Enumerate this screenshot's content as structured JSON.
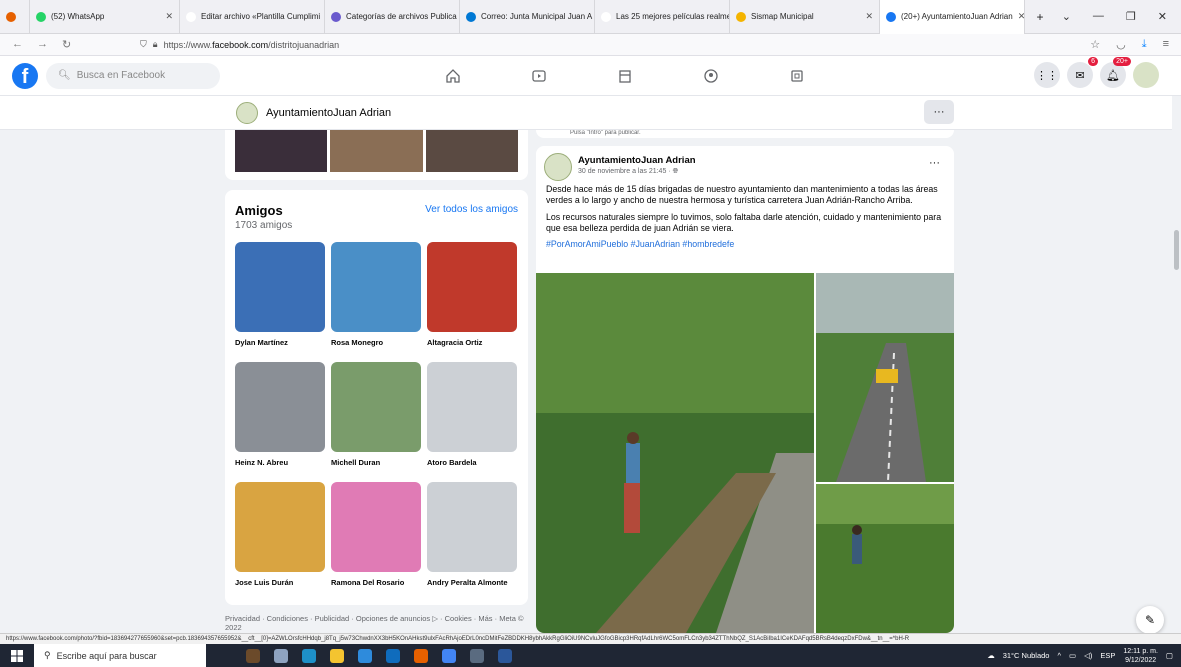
{
  "browser": {
    "tabs": [
      {
        "label": "(52) WhatsApp",
        "color": "#25d366",
        "width": 150
      },
      {
        "label": "Editar archivo «Plantilla Cumplimi",
        "color": "#ffffff",
        "width": 145
      },
      {
        "label": "Categorías de archivos Publica",
        "color": "#6a5acd",
        "width": 135
      },
      {
        "label": "Correo: Junta Municipal Juan A",
        "color": "#0078d4",
        "width": 135
      },
      {
        "label": "Las 25 mejores películas realmente",
        "color": "#ffffff",
        "width": 135
      },
      {
        "label": "Sismap Municipal",
        "color": "#f4b400",
        "width": 150
      },
      {
        "label": "(20+) AyuntamientoJuan Adrian",
        "color": "#1877f2",
        "width": 145
      }
    ],
    "new_tab": "+",
    "url_prefix": "https://www.",
    "url_domain": "facebook.com",
    "url_path": "/distritojuanadrian"
  },
  "facebook": {
    "search_placeholder": "Busca en Facebook",
    "messenger_badge": "6",
    "notifications_badge": "20+"
  },
  "page_header": {
    "name": "AyuntamientoJuan Adrian",
    "more": "···"
  },
  "friends": {
    "title": "Amigos",
    "count": "1703 amigos",
    "see_all": "Ver todos los amigos",
    "list": [
      {
        "name": "Dylan Martínez",
        "color": "#3b6fb6"
      },
      {
        "name": "Rosa Monegro",
        "color": "#4a8fc7"
      },
      {
        "name": "Altagracia Ortiz",
        "color": "#c0392b"
      },
      {
        "name": "Heinz N. Abreu",
        "color": "#8a8f96"
      },
      {
        "name": "Michell Duran",
        "color": "#7a9c6b"
      },
      {
        "name": "Atoro Bardela",
        "color": "#ccd0d5"
      },
      {
        "name": "Jose Luis Durán",
        "color": "#d9a441"
      },
      {
        "name": "Ramona Del Rosario",
        "color": "#e07bb5"
      },
      {
        "name": "Andry Peralta Almonte",
        "color": "#ccd0d5"
      }
    ]
  },
  "footer": "Privacidad · Condiciones · Publicidad · Opciones de anuncios ▷ · Cookies · Más · Meta © 2022",
  "previous_post_hint": "Pulsa \"Intro\" para publicar.",
  "post": {
    "author": "AyuntamientoJuan Adrian",
    "date": "30 de noviembre a las 21:45 ·",
    "more": "···",
    "paragraph1": "Desde hace más de 15 días brigadas de nuestro ayuntamiento dan mantenimiento a todas las áreas verdes a lo largo y ancho de nuestra hermosa y turística carretera Juan Adrián-Rancho Arriba.",
    "paragraph2": "Los recursos naturales siempre lo tuvimos, solo faltaba darle atención, cuidado y mantenimiento para que esa belleza perdida de juan Adrián se viera.",
    "hashtags": "#PorAmorAmiPueblo #JuanAdrian #hombredefe"
  },
  "status_url": "https://www.facebook.com/photo/?fbid=183694277655960&set=pcb.183694357655952&__cft__[0]=AZWLOrsfcHHdqb_j8Tq_j5w73ChwdnXX3bH5KOnAHkst9ulxFAcRhAjoEDrL0ncDMitFeZBDDKH8ybhAkkRgGliOiU9NCvluJGfoGBicp3HRqfAdLhr6WC5omFLCn3yb34ZTThNbQZ_S1AcBiIba1ICeKDAFqd5BRsB4deqzDxFDw&__tn__=*bH-R",
  "taskbar": {
    "search_placeholder": "Escribe aquí para buscar",
    "weather": "31°C Nublado",
    "lang": "ESP",
    "time": "12:11 p. m.",
    "date": "9/12/2022"
  }
}
